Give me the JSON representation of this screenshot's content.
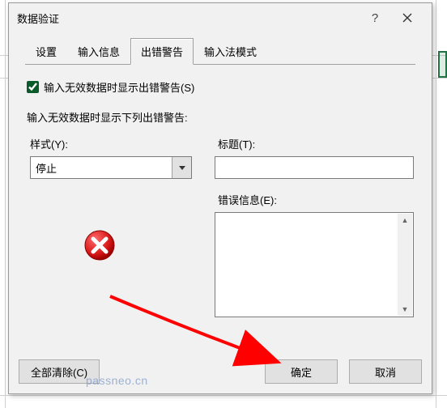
{
  "dialog": {
    "title": "数据验证",
    "tabs": [
      "设置",
      "输入信息",
      "出错警告",
      "输入法模式"
    ],
    "active_tab": "出错警告",
    "checkbox_label": "输入无效数据时显示出错警告(S)",
    "section_label": "输入无效数据时显示下列出错警告:",
    "style_label": "样式(Y):",
    "style_value": "停止",
    "title_label": "标题(T):",
    "title_value": "",
    "message_label": "错误信息(E):",
    "message_value": "",
    "clear_all": "全部清除(C)",
    "ok": "确定",
    "cancel": "取消"
  },
  "watermark": "passneo.cn"
}
